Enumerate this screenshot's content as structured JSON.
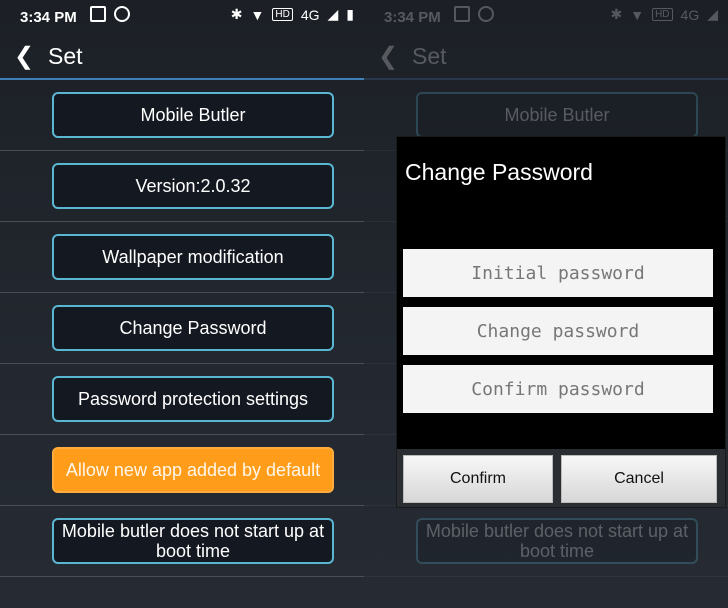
{
  "status": {
    "time": "3:34 PM",
    "net": "4G",
    "badge": "HD"
  },
  "header": {
    "back_icon": "chevron-left-icon",
    "title": "Set"
  },
  "menu": {
    "items": [
      "Mobile Butler",
      "Version:2.0.32",
      "Wallpaper modification",
      "Change Password",
      "Password protection settings",
      "Allow new app added by default",
      "Mobile butler does not start up at boot time"
    ]
  },
  "dialog": {
    "title": "Change Password",
    "fields": [
      "Initial password",
      "Change password",
      "Confirm password"
    ],
    "confirm": "Confirm",
    "cancel": "Cancel"
  },
  "colors": {
    "accent": "#59b7d2",
    "highlight": "#ff9d1b",
    "divider": "#3f7fb6"
  }
}
